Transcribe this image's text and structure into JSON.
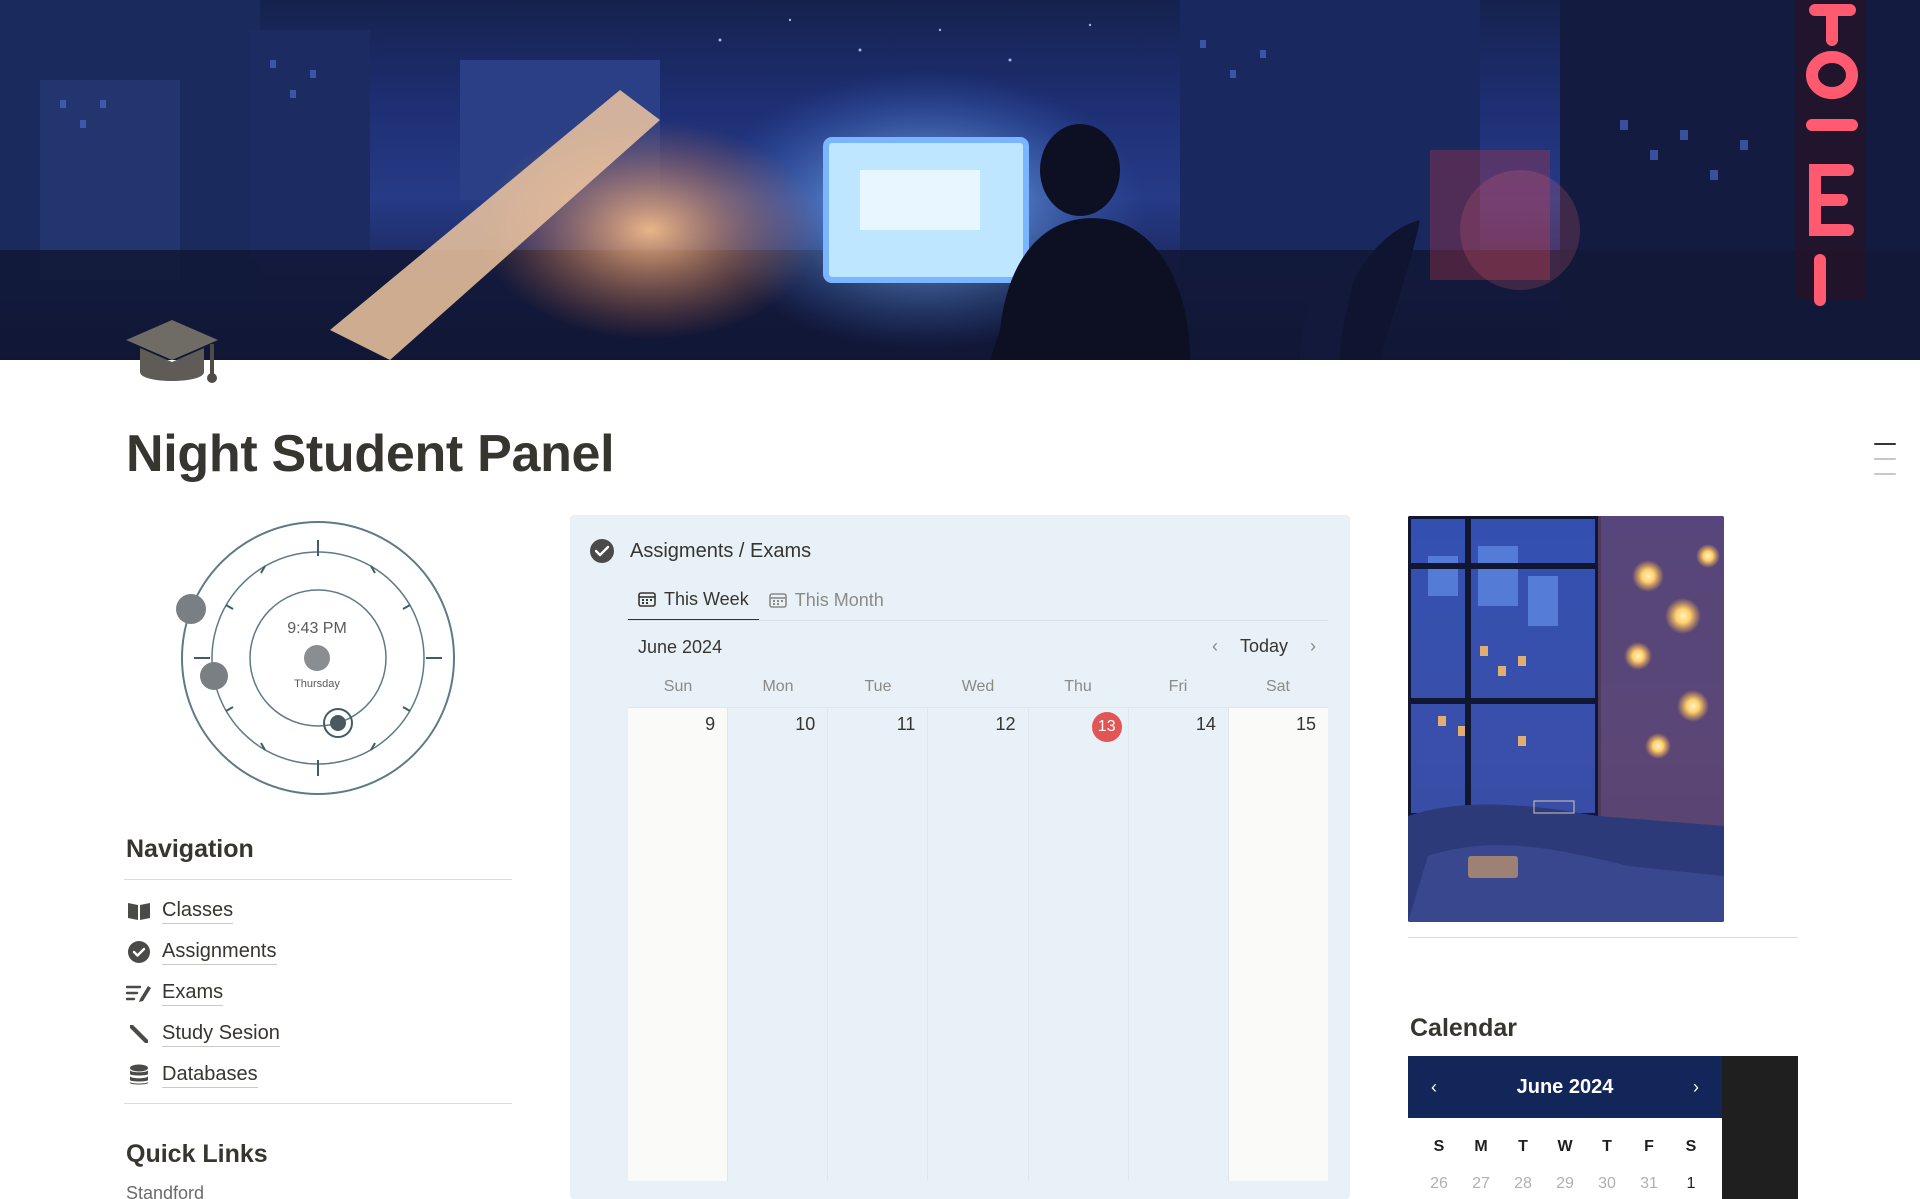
{
  "page": {
    "title": "Night Student Panel"
  },
  "clock": {
    "time": "9:43 PM",
    "day": "Thursday"
  },
  "navigation": {
    "heading": "Navigation",
    "items": [
      {
        "label": "Classes",
        "icon": "book-icon"
      },
      {
        "label": "Assignments",
        "icon": "check-circle-icon"
      },
      {
        "label": "Exams",
        "icon": "pencil-lines-icon"
      },
      {
        "label": "Study Sesion",
        "icon": "pen-icon"
      },
      {
        "label": "Databases",
        "icon": "database-icon"
      }
    ]
  },
  "quick_links": {
    "heading": "Quick Links",
    "items": [
      "Standford"
    ]
  },
  "assignments": {
    "title": "Assigments / Exams",
    "tabs": [
      {
        "label": "This Week",
        "active": true
      },
      {
        "label": "This Month",
        "active": false
      }
    ],
    "month_label": "June 2024",
    "today_button": "Today",
    "days_of_week": [
      "Sun",
      "Mon",
      "Tue",
      "Wed",
      "Thu",
      "Fri",
      "Sat"
    ],
    "week_dates": [
      "9",
      "10",
      "11",
      "12",
      "13",
      "14",
      "15"
    ],
    "today_date": "13"
  },
  "calendar": {
    "heading": "Calendar",
    "month_label": "June 2024",
    "days_of_week": [
      "S",
      "M",
      "T",
      "W",
      "T",
      "F",
      "S"
    ],
    "first_row": [
      "26",
      "27",
      "28",
      "29",
      "30",
      "31",
      "1"
    ]
  },
  "colors": {
    "today_badge": "#e25555",
    "panel_background": "#e8f1f8",
    "mini_calendar_header": "#12265a"
  }
}
